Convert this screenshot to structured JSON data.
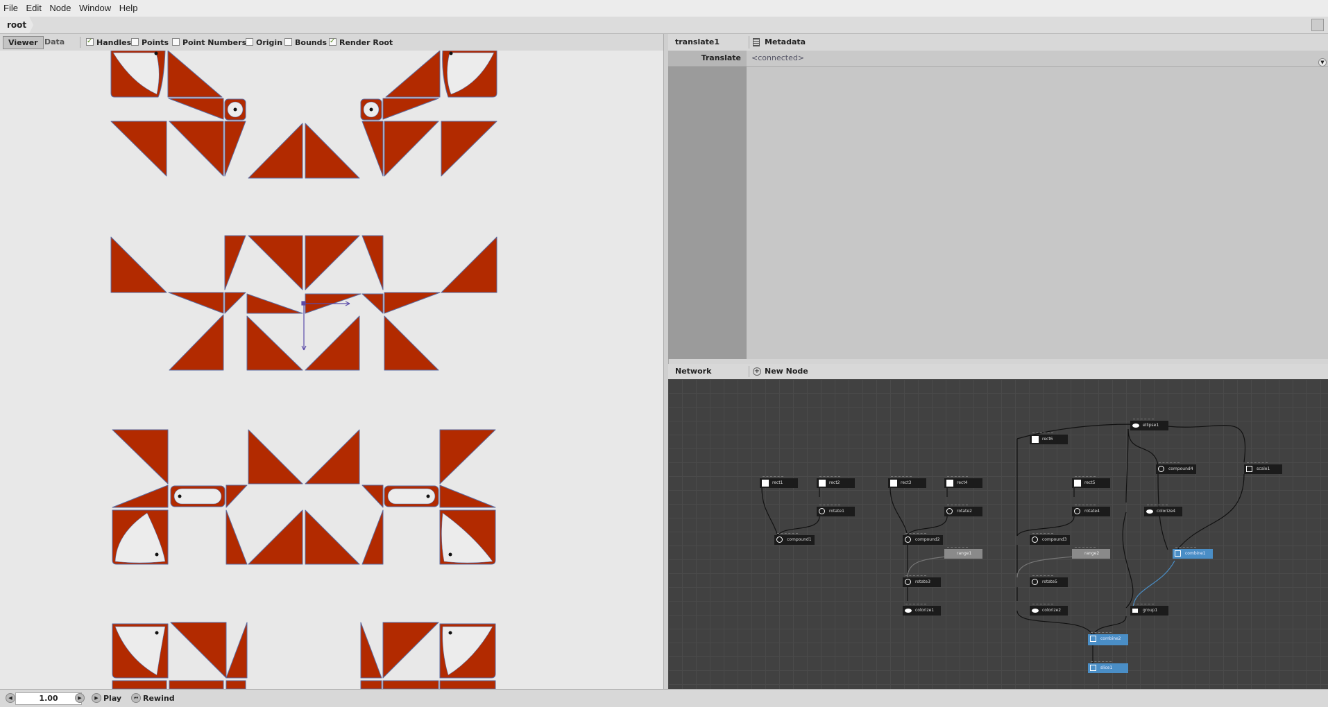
{
  "menu": [
    "File",
    "Edit",
    "Node",
    "Window",
    "Help"
  ],
  "breadcrumb": "root",
  "viewer_tabs": [
    "Viewer",
    "Data"
  ],
  "viewer_options": [
    {
      "label": "Handles",
      "checked": true
    },
    {
      "label": "Points",
      "checked": false
    },
    {
      "label": "Point Numbers",
      "checked": false
    },
    {
      "label": "Origin",
      "checked": false
    },
    {
      "label": "Bounds",
      "checked": false
    },
    {
      "label": "Render Root",
      "checked": true
    }
  ],
  "params": {
    "node_name": "translate1",
    "metadata_label": "Metadata",
    "label": "Translate",
    "value": "<connected>"
  },
  "network": {
    "title": "Network",
    "new_node_label": "New Node",
    "nodes": [
      "rect1",
      "rect2",
      "rotate1",
      "compound1",
      "rect3",
      "rect4",
      "rotate2",
      "compound2",
      "range1",
      "rotate3",
      "colorize1",
      "rect6",
      "rect5",
      "rotate4",
      "compound3",
      "range2",
      "rotate5",
      "colorize2",
      "ellipse1",
      "compound4",
      "colorize4",
      "combine1",
      "scale1",
      "group1",
      "combine2",
      "slice1"
    ]
  },
  "playback": {
    "frame": "1.00",
    "play_label": "Play",
    "rewind_label": "Rewind"
  },
  "colors": {
    "shape_fill": "#b22a00",
    "network_bg": "#414141",
    "selected_node": "#4a8ec6"
  }
}
